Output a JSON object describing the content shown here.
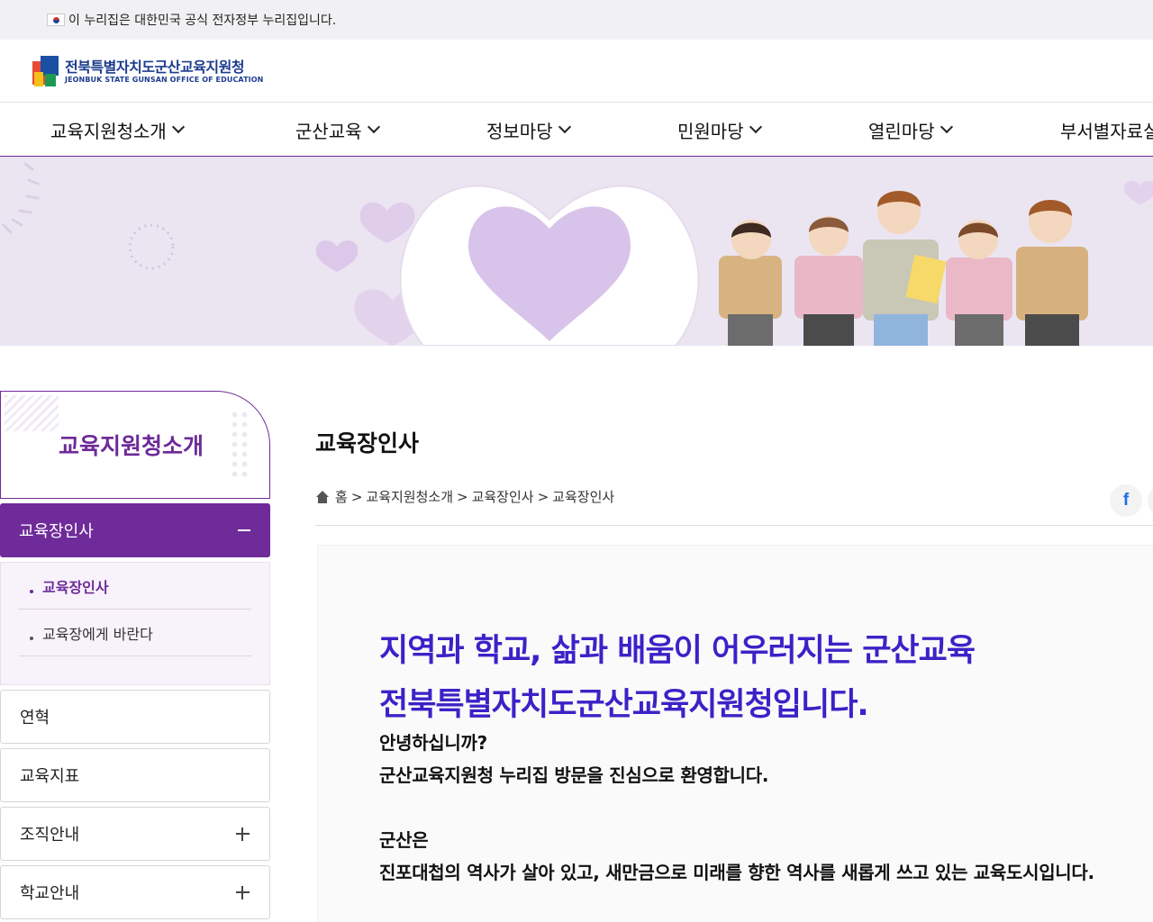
{
  "gov_banner": {
    "text": "이 누리집은 대한민국 공식 전자정부 누리집입니다."
  },
  "logo": {
    "name_ko": "전북특별자치도군산교육지원청",
    "name_en": "JEONBUK STATE GUNSAN OFFICE OF EDUCATION"
  },
  "gnb": {
    "items": [
      {
        "label": "교육지원청소개"
      },
      {
        "label": "군산교육"
      },
      {
        "label": "정보마당"
      },
      {
        "label": "민원마당"
      },
      {
        "label": "열린마당"
      },
      {
        "label": "부서별자료실"
      }
    ]
  },
  "sidebar": {
    "title": "교육지원청소개",
    "active": {
      "label": "교육장인사"
    },
    "sub_items": [
      {
        "label": "교육장인사"
      },
      {
        "label": "교육장에게 바란다"
      }
    ],
    "items": [
      {
        "label": "연혁"
      },
      {
        "label": "교육지표"
      },
      {
        "label": "조직안내"
      },
      {
        "label": "학교안내"
      }
    ]
  },
  "content": {
    "title": "교육장인사",
    "breadcrumb": [
      "홈",
      "교육지원청소개",
      "교육장인사",
      "교육장인사"
    ],
    "share": {
      "facebook": "f"
    },
    "headline": [
      "지역과 학교, 삶과 배움이 어우러지는 군산교육",
      "전북특별자치도군산교육지원청입니다."
    ],
    "paragraphs": [
      "안녕하십니까?",
      "군산교육지원청 누리집 방문을 진심으로 환영합니다.",
      "군산은",
      "진포대첩의 역사가 살아 있고, 새만금으로 미래를 향한 역사를 새롭게 쓰고 있는 교육도시입니다."
    ]
  },
  "colors": {
    "brand": "#6e2a98",
    "headline": "#3b22c7",
    "hero_bg": "#ebe5f2"
  }
}
